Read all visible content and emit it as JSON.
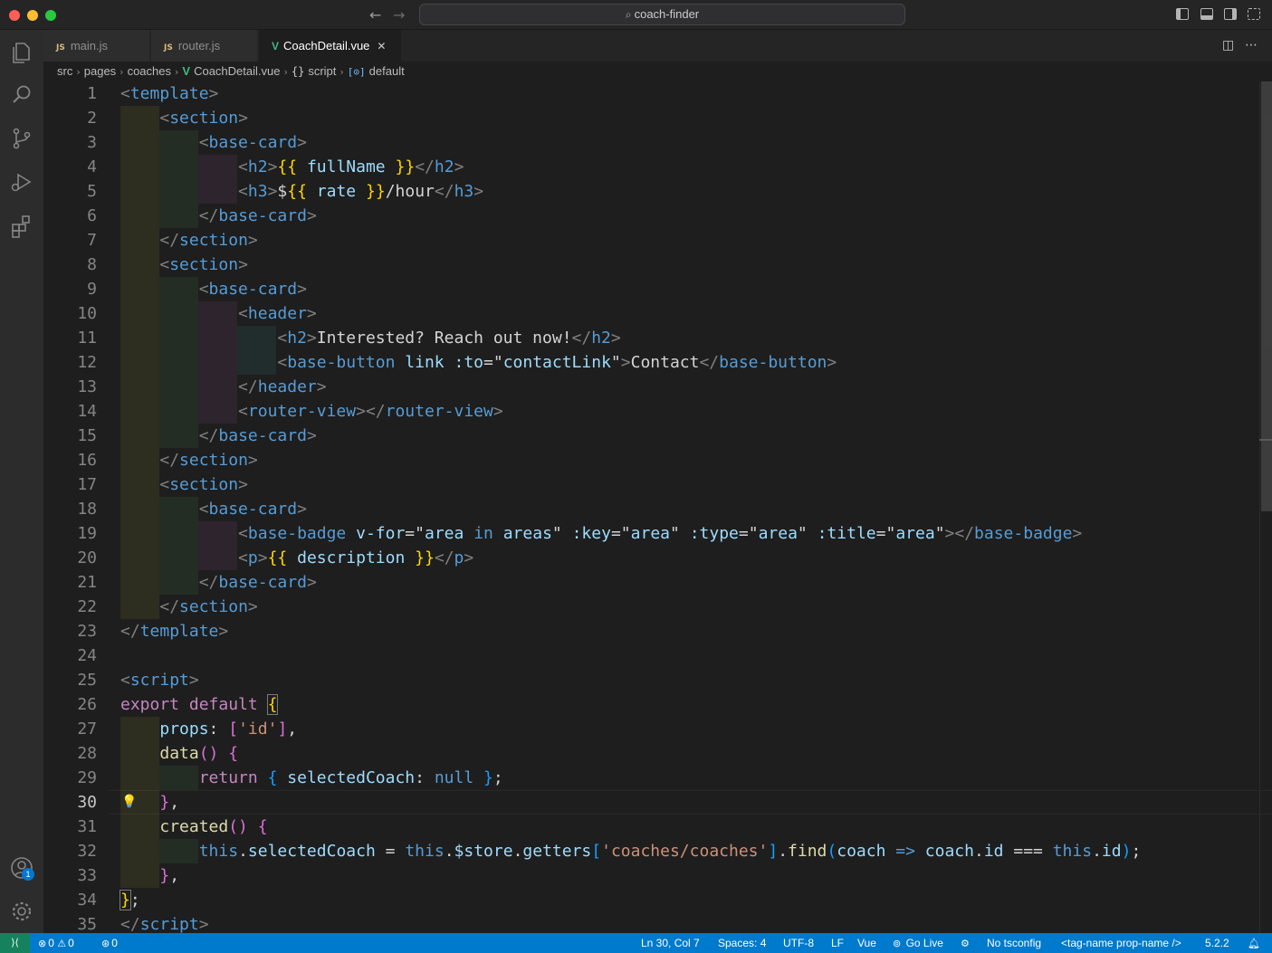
{
  "window": {
    "search_label": "coach-finder"
  },
  "tabs": [
    {
      "label": "main.js",
      "icon": "js-file-icon"
    },
    {
      "label": "router.js",
      "icon": "js-file-icon"
    },
    {
      "label": "CoachDetail.vue",
      "icon": "vue-file-icon",
      "active": true
    }
  ],
  "icon_labels": {
    "js": "JS",
    "vue": "V",
    "braces": "{}",
    "symbol": "[⊙]"
  },
  "breadcrumbs": [
    "src",
    "pages",
    "coaches",
    "CoachDetail.vue",
    "script",
    "default"
  ],
  "editor": {
    "current_line": 30,
    "line_numbers": [
      "1",
      "2",
      "3",
      "4",
      "5",
      "6",
      "7",
      "8",
      "9",
      "10",
      "11",
      "12",
      "13",
      "14",
      "15",
      "16",
      "17",
      "18",
      "19",
      "20",
      "21",
      "22",
      "23",
      "24",
      "25",
      "26",
      "27",
      "28",
      "29",
      "30",
      "31",
      "32",
      "33",
      "34",
      "35"
    ],
    "code": {
      "template": "template",
      "section": "section",
      "base_card": "base-card",
      "h2": "h2",
      "h3": "h3",
      "full_name": "fullName",
      "dollar": "$",
      "rate": "rate",
      "hour": "/hour",
      "header": "header",
      "interested": "Interested? Reach out now!",
      "base_button": "base-button",
      "link": "link",
      "to_attr": ":to",
      "contact_link": "contactLink",
      "contact": "Contact",
      "router_view": "router-view",
      "base_badge": "base-badge",
      "v_for": "v-for",
      "area": "area",
      "in": "in",
      "areas": "areas",
      "key_attr": ":key",
      "type_attr": ":type",
      "title_attr": ":title",
      "p": "p",
      "description": "description",
      "script": "script",
      "export": "export",
      "default": "default",
      "props": "props",
      "id_str": "'id'",
      "data": "data",
      "return": "return",
      "selected_coach": "selectedCoach",
      "null": "null",
      "created": "created",
      "this": "this",
      "store": "$store",
      "getters": "getters",
      "coaches_str": "'coaches/coaches'",
      "find": "find",
      "coach": "coach",
      "arrow": "=>",
      "id": "id",
      "strict_eq": "==="
    }
  },
  "statusbar": {
    "errors": "0",
    "warnings": "0",
    "ports": "0",
    "position": "Ln 30, Col 7",
    "spaces": "Spaces: 4",
    "encoding": "UTF-8",
    "eol": "LF",
    "language": "Vue",
    "go_live": "Go Live",
    "tsconfig": "No tsconfig",
    "tag_style": "<tag-name prop-name />",
    "version": "5.2.2"
  },
  "accounts_badge": "1",
  "colors": {
    "accent": "#007acc",
    "remote": "#16825d",
    "vue_green": "#41b883",
    "tag_blue": "#569cd6",
    "attr_blue": "#9cdcfe",
    "string_orange": "#ce9178",
    "keyword_purple": "#c586c0",
    "function_yellow": "#dcdcaa",
    "bracket_gold": "#ffd700"
  }
}
